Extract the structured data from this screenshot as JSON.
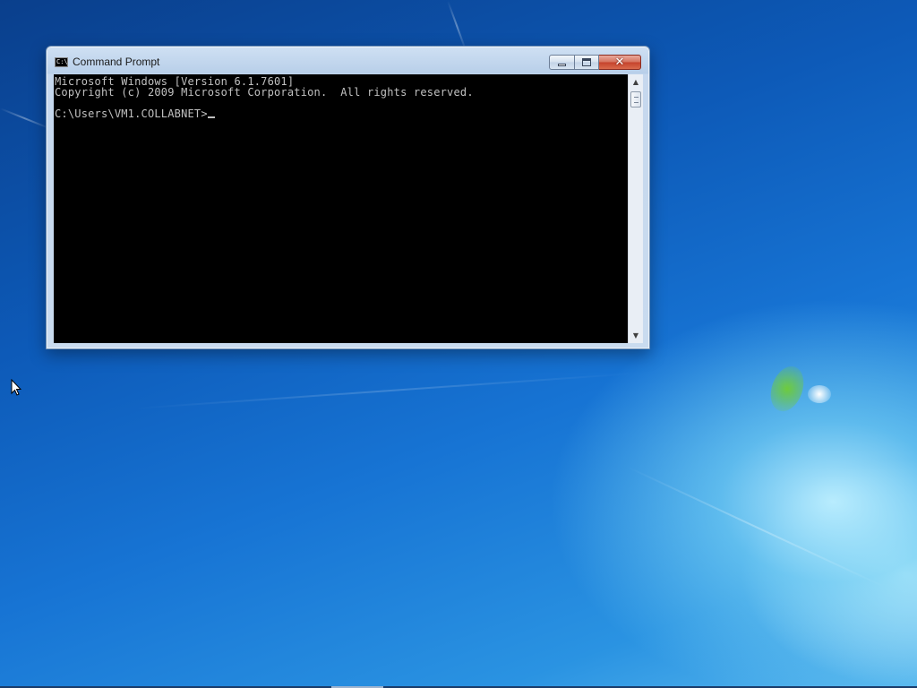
{
  "window": {
    "title": "Command Prompt",
    "icon": "cmd-icon",
    "icon_text": "C:\\",
    "buttons": {
      "minimize": "minimize-icon",
      "maximize": "maximize-icon",
      "close": "close-icon",
      "close_glyph": "✕"
    }
  },
  "console": {
    "lines": [
      "Microsoft Windows [Version 6.1.7601]",
      "Copyright (c) 2009 Microsoft Corporation.  All rights reserved.",
      "",
      "C:\\Users\\VM1.COLLABNET>"
    ],
    "background": "#000000",
    "foreground": "#c0c0c0"
  },
  "scrollbar": {
    "up_glyph": "▲",
    "down_glyph": "▼"
  },
  "desktop": {
    "accent": "#1774d4"
  }
}
